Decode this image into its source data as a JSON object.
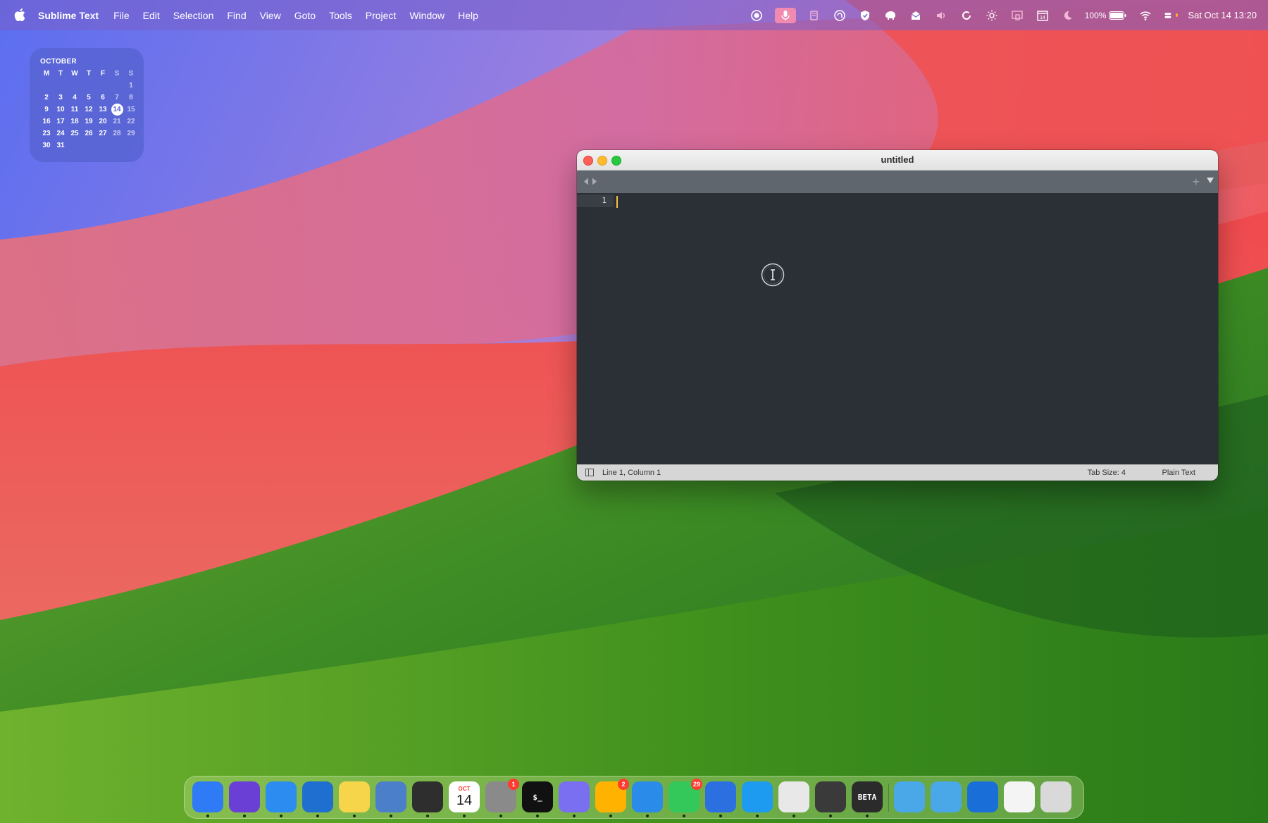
{
  "menubar": {
    "app_name": "Sublime Text",
    "menus": [
      "File",
      "Edit",
      "Selection",
      "Find",
      "View",
      "Goto",
      "Tools",
      "Project",
      "Window",
      "Help"
    ],
    "status_icons": [
      "record-icon",
      "microphone-icon",
      "cup-icon",
      "vpn-icon",
      "shield-icon",
      "elephant-icon",
      "mail-icon",
      "volume-icon",
      "refresh-icon",
      "brightness-icon",
      "display-icon",
      "calendar-icon",
      "moon-icon"
    ],
    "battery": "100%",
    "datetime": "Sat Oct 14  13:20"
  },
  "calendar_widget": {
    "month": "OCTOBER",
    "weekdays": [
      "M",
      "T",
      "W",
      "T",
      "F",
      "S",
      "S"
    ],
    "weeks": [
      [
        "",
        "",
        "",
        "",
        "",
        "",
        "1"
      ],
      [
        "2",
        "3",
        "4",
        "5",
        "6",
        "7",
        "8"
      ],
      [
        "9",
        "10",
        "11",
        "12",
        "13",
        "14",
        "15"
      ],
      [
        "16",
        "17",
        "18",
        "19",
        "20",
        "21",
        "22"
      ],
      [
        "23",
        "24",
        "25",
        "26",
        "27",
        "28",
        "29"
      ],
      [
        "30",
        "31",
        "",
        "",
        "",
        "",
        ""
      ]
    ],
    "today": "14"
  },
  "window": {
    "title": "untitled",
    "line_number": "1",
    "status": {
      "position": "Line 1, Column 1",
      "tab_size": "Tab Size: 4",
      "syntax": "Plain Text"
    }
  },
  "dock": {
    "apps": [
      {
        "name": "finder",
        "color": "#2f7bf5"
      },
      {
        "name": "mail-purple",
        "color": "#6a3fd6"
      },
      {
        "name": "mail",
        "color": "#2d8cf0"
      },
      {
        "name": "vscode",
        "color": "#1f6fd0"
      },
      {
        "name": "notes",
        "color": "#f7d54a"
      },
      {
        "name": "preview",
        "color": "#4b7fc9"
      },
      {
        "name": "sublime-text",
        "color": "#2e2e2e"
      },
      {
        "name": "calendar",
        "color": "#ffffff",
        "label_top": "OCT",
        "label": "14"
      },
      {
        "name": "system-settings",
        "color": "#8a8a8a",
        "badge": "1"
      },
      {
        "name": "terminal",
        "color": "#111111",
        "label": "$_"
      },
      {
        "name": "stack-app",
        "color": "#7a6ff0"
      },
      {
        "name": "whatsapp",
        "color": "#ffb300",
        "badge": "2"
      },
      {
        "name": "safari",
        "color": "#2a8be8"
      },
      {
        "name": "messages",
        "color": "#34c759",
        "badge": "29"
      },
      {
        "name": "xcode",
        "color": "#2c6fe0"
      },
      {
        "name": "twitter",
        "color": "#1d9bf0"
      },
      {
        "name": "script-editor",
        "color": "#e8e8e8"
      },
      {
        "name": "quicktime",
        "color": "#3a3a3a"
      },
      {
        "name": "chatgpt-beta",
        "color": "#2b2b2b",
        "label": "BETA"
      },
      {
        "name": "downloads-folder",
        "color": "#4aa8e8"
      },
      {
        "name": "documents-folder",
        "color": "#4aa8e8"
      },
      {
        "name": "1password",
        "color": "#1a6ed8"
      },
      {
        "name": "textedit",
        "color": "#f4f4f4"
      },
      {
        "name": "trash",
        "color": "#d9d9d9"
      }
    ]
  }
}
